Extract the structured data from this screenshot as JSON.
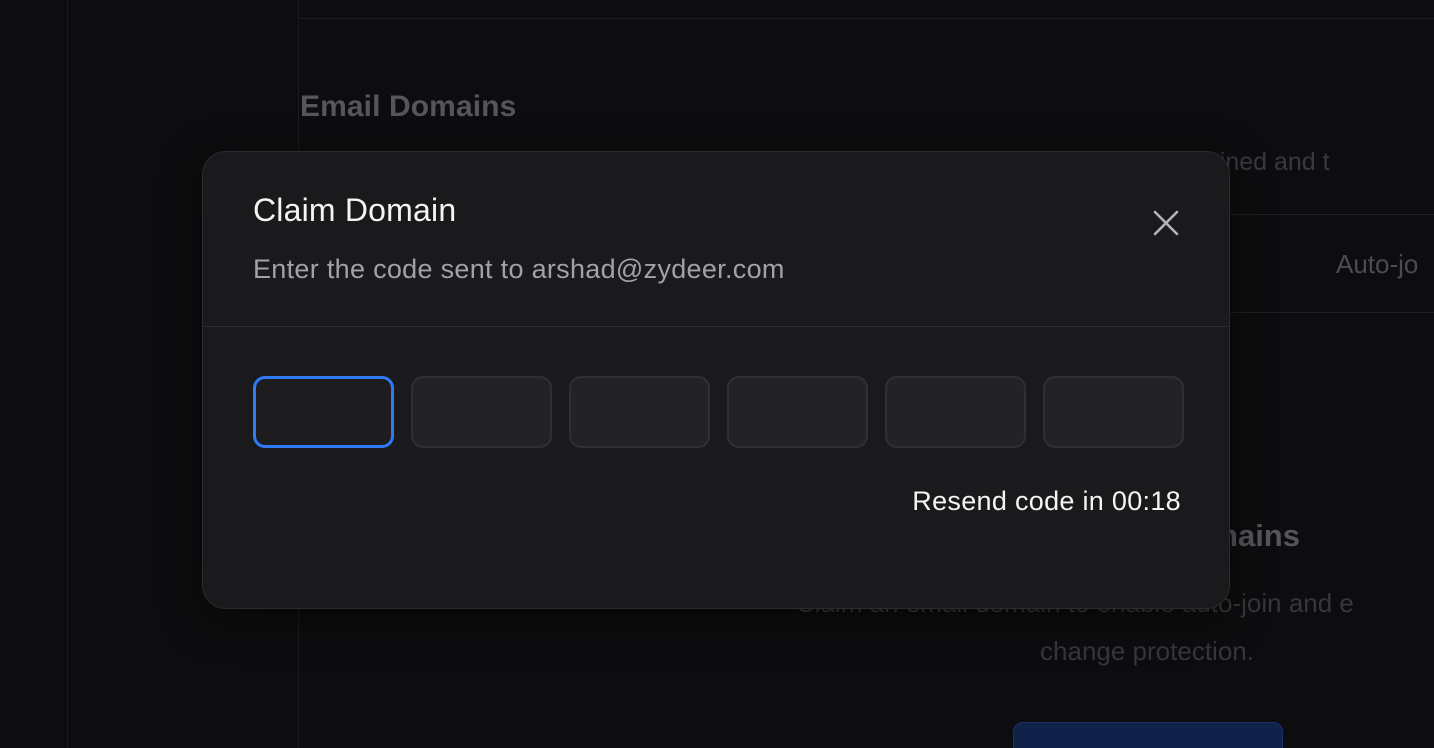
{
  "background": {
    "section_title": "Email Domains",
    "section_description": "Claim and verify your email domains. Members with matching emails will be auto-joined and t",
    "table": {
      "column_auto_join": "Auto-jo"
    },
    "empty_state": {
      "title": "mains",
      "description_line1": "Claim an email domain to enable auto-join and e",
      "description_line2": "change protection."
    }
  },
  "modal": {
    "title": "Claim Domain",
    "subtitle": "Enter the code sent to arshad@zydeer.com",
    "close_icon": "close-icon",
    "otp": {
      "length": 6,
      "digits": [
        "",
        "",
        "",
        "",
        "",
        ""
      ],
      "active_index": 0
    },
    "resend_text": "Resend code in 00:18"
  },
  "colors": {
    "accent": "#2f7bf5",
    "modal_bg": "#1a1a1c",
    "page_bg": "#0d0d0f"
  }
}
